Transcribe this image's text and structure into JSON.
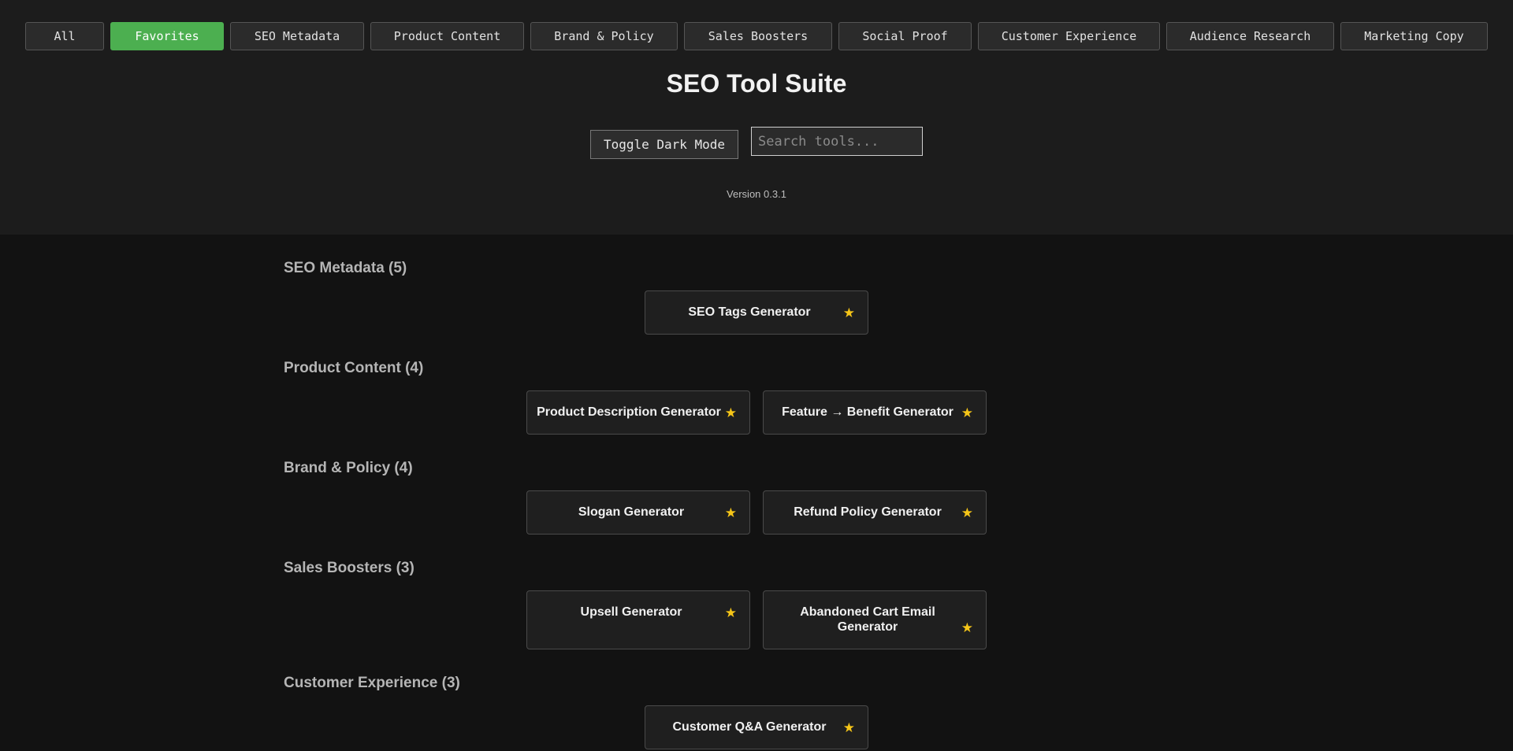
{
  "filters": [
    {
      "label": "All",
      "active": false
    },
    {
      "label": "Favorites",
      "active": true
    },
    {
      "label": "SEO Metadata",
      "active": false
    },
    {
      "label": "Product Content",
      "active": false
    },
    {
      "label": "Brand & Policy",
      "active": false
    },
    {
      "label": "Sales Boosters",
      "active": false
    },
    {
      "label": "Social Proof",
      "active": false
    },
    {
      "label": "Customer Experience",
      "active": false
    },
    {
      "label": "Audience Research",
      "active": false
    },
    {
      "label": "Marketing Copy",
      "active": false
    }
  ],
  "header": {
    "title": "SEO Tool Suite",
    "toggle_label": "Toggle Dark Mode",
    "search_placeholder": "Search tools...",
    "version": "Version 0.3.1"
  },
  "sections": [
    {
      "title": "SEO Metadata (5)",
      "tools": [
        {
          "name": "SEO Tags Generator",
          "icon": "star-icon"
        }
      ]
    },
    {
      "title": "Product Content (4)",
      "tools": [
        {
          "name": "Product Description Generator",
          "icon": "star-icon"
        },
        {
          "name": "Feature → Benefit Generator",
          "icon": "star-icon"
        }
      ]
    },
    {
      "title": "Brand & Policy (4)",
      "tools": [
        {
          "name": "Slogan Generator",
          "icon": "star-icon"
        },
        {
          "name": "Refund Policy Generator",
          "icon": "star-icon"
        }
      ]
    },
    {
      "title": "Sales Boosters (3)",
      "tools": [
        {
          "name": "Upsell Generator",
          "icon": "star-icon"
        },
        {
          "name": "Abandoned Cart Email Generator",
          "icon": "star-icon"
        }
      ]
    },
    {
      "title": "Customer Experience (3)",
      "tools": [
        {
          "name": "Customer Q&A Generator",
          "icon": "star-icon"
        }
      ]
    }
  ],
  "colors": {
    "accent": "#4caf50",
    "star": "#f5c518",
    "background": "#121212",
    "header_background": "#1c1c1c"
  }
}
